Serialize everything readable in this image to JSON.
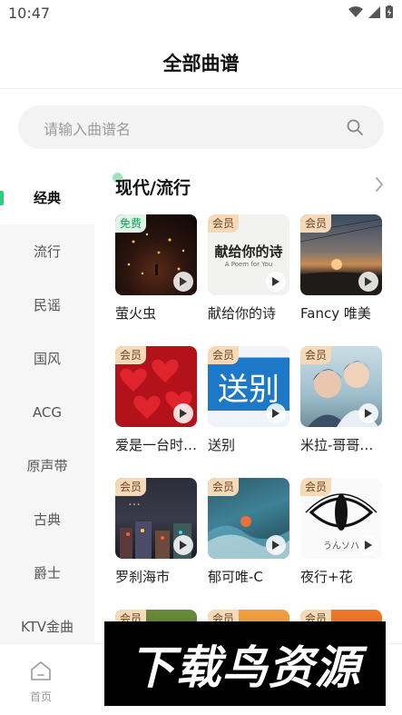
{
  "status_bar": {
    "time": "10:47"
  },
  "header": {
    "title": "全部曲谱"
  },
  "search": {
    "placeholder": "请输入曲谱名"
  },
  "sidebar": {
    "items": [
      {
        "label": "经典",
        "active": true
      },
      {
        "label": "流行"
      },
      {
        "label": "民谣"
      },
      {
        "label": "国风"
      },
      {
        "label": "ACG"
      },
      {
        "label": "原声带"
      },
      {
        "label": "古典"
      },
      {
        "label": "爵士"
      },
      {
        "label": "KTV金曲"
      }
    ]
  },
  "section": {
    "title": "现代/流行"
  },
  "cards": [
    {
      "badge": "免费",
      "title": "萤火虫",
      "cover": "fireflies-night"
    },
    {
      "badge": "会员",
      "title": "献给你的诗",
      "cover_title": "献给你的诗",
      "cover_subtitle": "A Poem for You"
    },
    {
      "badge": "会员",
      "title": "Fancy 唯美",
      "cover": "sunset-field"
    },
    {
      "badge": "会员",
      "title": "爱是一台时光机",
      "cover": "red-hearts"
    },
    {
      "badge": "会员",
      "title": "送别",
      "cover_title": "送别"
    },
    {
      "badge": "会员",
      "title": "米拉-哥哥的爱",
      "cover": "two-boys"
    },
    {
      "badge": "会员",
      "title": "罗刹海市",
      "cover": "night-city"
    },
    {
      "badge": "会员",
      "title": "郁可唯-C",
      "cover": "ocean-waves"
    },
    {
      "badge": "会员",
      "title": "夜行+花",
      "cover": "black-eye",
      "cover_caption": "うんソハ"
    },
    {
      "badge": "会员",
      "title": ""
    },
    {
      "badge": "会员",
      "title": ""
    },
    {
      "badge": "会员",
      "title": ""
    }
  ],
  "tabbar": {
    "home_label": "首页"
  },
  "watermark": {
    "text": "下载鸟资源"
  },
  "colors": {
    "accent": "#2ecb7a",
    "vip_badge": "#f5d9b8",
    "free_badge": "#dff5e8"
  }
}
